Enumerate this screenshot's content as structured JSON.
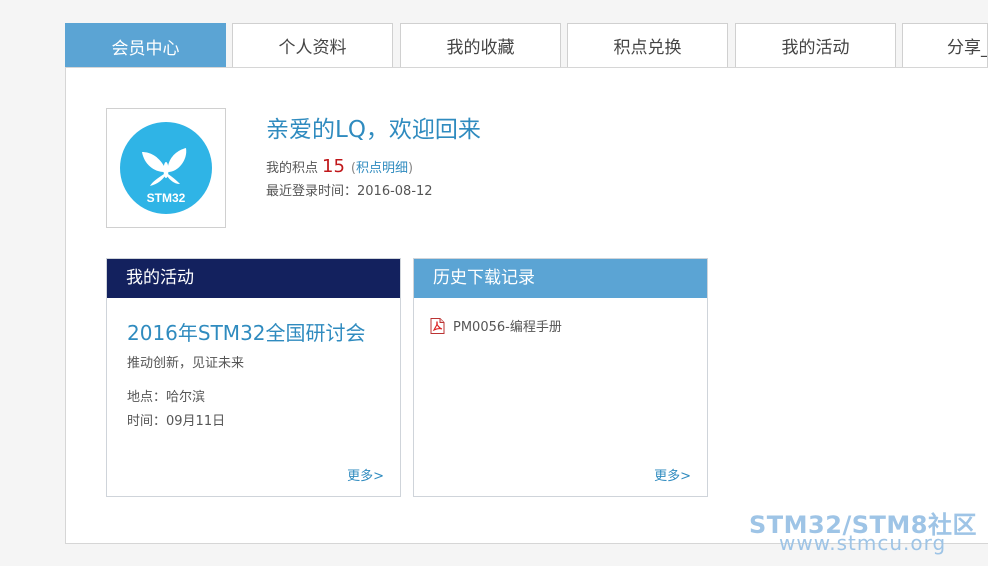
{
  "tabs": [
    {
      "label": "会员中心",
      "active": true
    },
    {
      "label": "个人资料"
    },
    {
      "label": "我的收藏"
    },
    {
      "label": "积点兑换"
    },
    {
      "label": "我的活动"
    },
    {
      "label": "分享_"
    }
  ],
  "profile": {
    "avatar_text": "STM32",
    "welcome": "亲爱的LQ，欢迎回来",
    "points_label": "我的积点",
    "points_value": "15",
    "points_link": "积点明细",
    "login_label": "最近登录时间：",
    "login_date": "2016-08-12"
  },
  "activity_card": {
    "title": "我的活动",
    "event_title": "2016年STM32全国研讨会",
    "event_subtitle": "推动创新，见证未来",
    "place": "地点：哈尔滨",
    "time": "时间：09月11日",
    "more": "更多>"
  },
  "history_card": {
    "title": "历史下载记录",
    "items": [
      {
        "name": "PM0056-编程手册",
        "icon": "pdf-icon"
      }
    ],
    "more": "更多>"
  },
  "watermark": {
    "line1": "STM32/STM8社区",
    "line2": "www.stmcu.org"
  },
  "colors": {
    "tab_active": "#5ba4d4",
    "activity_header": "#13215e",
    "history_header": "#5ba4d4",
    "link": "#2f8bbf",
    "points": "#c0171a"
  }
}
